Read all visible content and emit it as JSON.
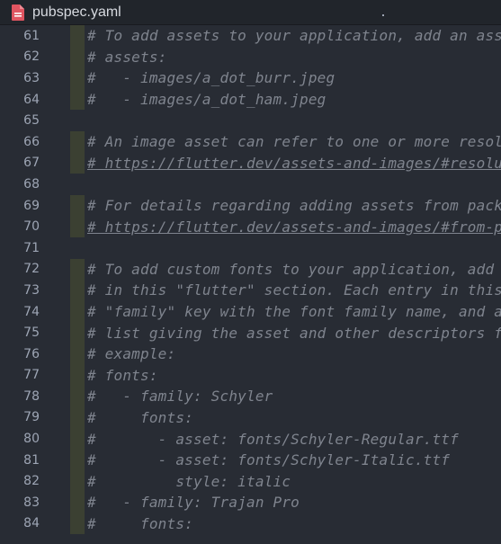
{
  "tab": {
    "title": "pubspec.yaml",
    "icon": "yaml-file-icon",
    "icon_color": "#e05561"
  },
  "colors": {
    "background": "#282c34",
    "comment": "#7f848e",
    "line_number": "#9da5b4",
    "indent_guide": "#3b4032"
  },
  "lines": [
    {
      "num": "61",
      "text": "# To add assets to your application, add an asse",
      "guide": true,
      "link": false
    },
    {
      "num": "62",
      "text": "# assets:",
      "guide": true,
      "link": false
    },
    {
      "num": "63",
      "text": "#   - images/a_dot_burr.jpeg",
      "guide": true,
      "link": false
    },
    {
      "num": "64",
      "text": "#   - images/a_dot_ham.jpeg",
      "guide": true,
      "link": false
    },
    {
      "num": "65",
      "text": "",
      "guide": false,
      "link": false
    },
    {
      "num": "66",
      "text": "# An image asset can refer to one or more resolu",
      "guide": true,
      "link": false
    },
    {
      "num": "67",
      "text": "# https://flutter.dev/assets-and-images/#resolut",
      "guide": true,
      "link": true
    },
    {
      "num": "68",
      "text": "",
      "guide": false,
      "link": false
    },
    {
      "num": "69",
      "text": "# For details regarding adding assets from packa",
      "guide": true,
      "link": false
    },
    {
      "num": "70",
      "text": "# https://flutter.dev/assets-and-images/#from-pa",
      "guide": true,
      "link": true
    },
    {
      "num": "71",
      "text": "",
      "guide": false,
      "link": false
    },
    {
      "num": "72",
      "text": "# To add custom fonts to your application, add a",
      "guide": true,
      "link": false
    },
    {
      "num": "73",
      "text": "# in this \"flutter\" section. Each entry in this",
      "guide": true,
      "link": false
    },
    {
      "num": "74",
      "text": "# \"family\" key with the font family name, and a",
      "guide": true,
      "link": false
    },
    {
      "num": "75",
      "text": "# list giving the asset and other descriptors fo",
      "guide": true,
      "link": false
    },
    {
      "num": "76",
      "text": "# example:",
      "guide": true,
      "link": false
    },
    {
      "num": "77",
      "text": "# fonts:",
      "guide": true,
      "link": false
    },
    {
      "num": "78",
      "text": "#   - family: Schyler",
      "guide": true,
      "link": false
    },
    {
      "num": "79",
      "text": "#     fonts:",
      "guide": true,
      "link": false
    },
    {
      "num": "80",
      "text": "#       - asset: fonts/Schyler-Regular.ttf",
      "guide": true,
      "link": false
    },
    {
      "num": "81",
      "text": "#       - asset: fonts/Schyler-Italic.ttf",
      "guide": true,
      "link": false
    },
    {
      "num": "82",
      "text": "#         style: italic",
      "guide": true,
      "link": false
    },
    {
      "num": "83",
      "text": "#   - family: Trajan Pro",
      "guide": true,
      "link": false
    },
    {
      "num": "84",
      "text": "#     fonts:",
      "guide": true,
      "link": false
    }
  ]
}
